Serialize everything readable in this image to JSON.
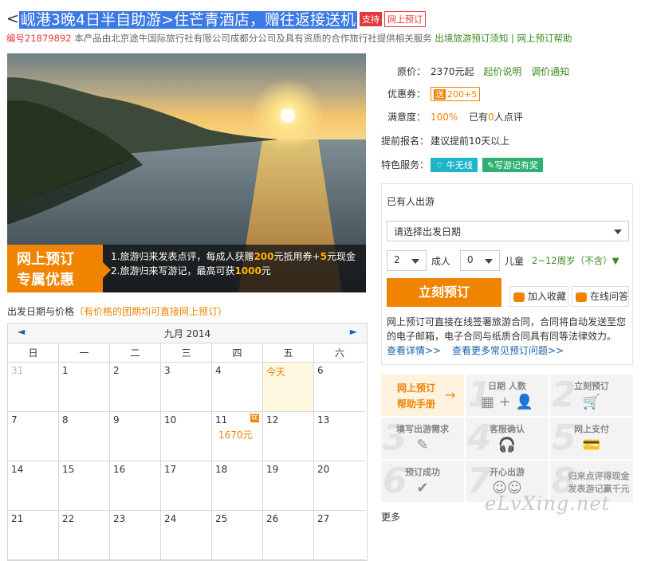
{
  "header": {
    "lt": "<",
    "title": "岘港3晚4日半自助游>住芒青酒店，赠往返接送机",
    "tag_support": "支持",
    "tag_online": "网上预订"
  },
  "subline": {
    "code": "编号21879892",
    "desc": "本产品由北京途牛国际旅行社有限公司成都分公司及具有资质的合作旅行社提供相关服务",
    "link1": "出境旅游预订须知",
    "sep": "|",
    "link2": "网上预订帮助"
  },
  "promo": {
    "badge_line1": "网上预订",
    "badge_line2": "专属优惠",
    "line1": {
      "a": "1.旅游归来发表点评，每成人获赠",
      "b": "200",
      "c": "元抵用券+",
      "d": "5",
      "e": "元现金"
    },
    "line2": {
      "a": "2.旅游归来写游记，最高可获",
      "b": "1000",
      "c": "元"
    }
  },
  "calendar_label": {
    "main": "出发日期与价格",
    "note": "（有价格的团期均可直接网上预订）"
  },
  "calendar": {
    "prev": "◄",
    "next": "►",
    "month": "九月 2014",
    "weekdays": [
      "日",
      "一",
      "二",
      "三",
      "四",
      "五",
      "六"
    ],
    "rows": [
      [
        {
          "d": "31",
          "dim": true
        },
        {
          "d": "1"
        },
        {
          "d": "2"
        },
        {
          "d": "3"
        },
        {
          "d": "4"
        },
        {
          "d": "今天",
          "today": true
        },
        {
          "d": "6"
        }
      ],
      [
        {
          "d": "7"
        },
        {
          "d": "8"
        },
        {
          "d": "9"
        },
        {
          "d": "10"
        },
        {
          "d": "11",
          "price": "1670元",
          "promo": "促"
        },
        {
          "d": "12"
        },
        {
          "d": "13"
        }
      ],
      [
        {
          "d": "14"
        },
        {
          "d": "15"
        },
        {
          "d": "16"
        },
        {
          "d": "17"
        },
        {
          "d": "18"
        },
        {
          "d": "19"
        },
        {
          "d": "20"
        }
      ],
      [
        {
          "d": "21"
        },
        {
          "d": "22"
        },
        {
          "d": "23"
        },
        {
          "d": "24"
        },
        {
          "d": "25"
        },
        {
          "d": "26"
        },
        {
          "d": "27"
        }
      ]
    ]
  },
  "info": {
    "price_key": "原价：",
    "price_val": "2370元起",
    "price_link1": "起价说明",
    "price_link2": "调价通知",
    "coupon_key": "优惠券：",
    "coupon_c1": "送",
    "coupon_c2": "200+5",
    "sat_key": "满意度：",
    "sat_val": "100%",
    "sat_rest1": "已有",
    "sat_count": "0",
    "sat_rest2": "人点评",
    "adv_key": "提前报名：",
    "adv_val": "建议提前10天以上",
    "svc_key": "特色服务：",
    "svc1": "牛无线",
    "svc2": "写游记有奖",
    "svc1_color": "#1fb5c8",
    "svc2_color": "#2db070"
  },
  "booking": {
    "already": "已有人出游",
    "date_placeholder": "请选择出发日期",
    "adult_count": "2",
    "adult_label": "成人",
    "child_count": "0",
    "child_label": "儿童",
    "child_note": "2~12周岁（不含）▼",
    "book_btn": "立刻预订",
    "fav_btn": "加入收藏",
    "ask_btn": "在线问答",
    "text": "网上预订可直接在线签署旅游合同，合同将自动发送至您的电子邮箱，电子合同与纸质合同具有同等法律效力。",
    "link_detail": "查看详情>>",
    "link_faq": "查看更多常见预订问题>>"
  },
  "help": {
    "first_l1": "网上预订",
    "first_l2": "帮助手册",
    "first_arrow": "→",
    "cells": [
      {
        "n": "1",
        "t": "日期  人数",
        "g": "▦ + 👤"
      },
      {
        "n": "2",
        "t": "立刻预订",
        "g": "🛒"
      },
      {
        "n": "3",
        "t": "填写出游需求",
        "g": "✎"
      },
      {
        "n": "4",
        "t": "客服确认",
        "g": "🎧"
      },
      {
        "n": "5",
        "t": "网上支付",
        "g": "💳"
      },
      {
        "n": "6",
        "t": "预订成功",
        "g": "✔"
      },
      {
        "n": "7",
        "t": "开心出游",
        "g": "☺☺"
      },
      {
        "n": "8",
        "t": "归来点评得现金\n发表游记赢千元",
        "g": ""
      }
    ]
  },
  "more": "更多",
  "watermark": "eLvXing.net"
}
